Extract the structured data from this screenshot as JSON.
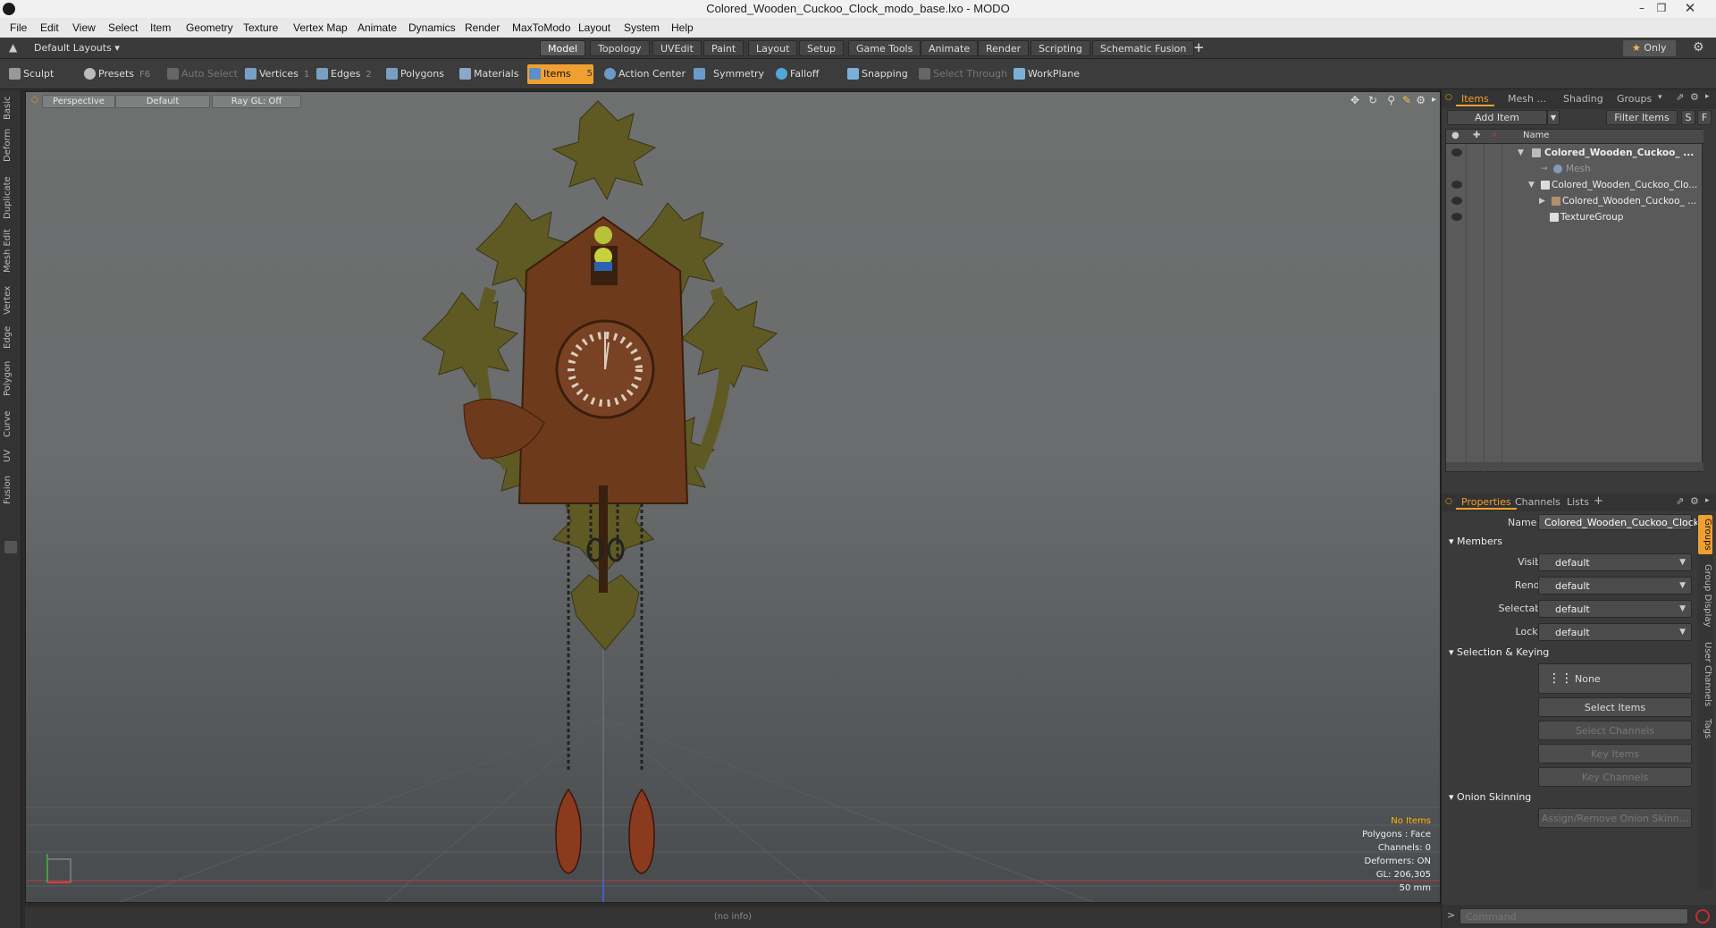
{
  "window": {
    "title": "Colored_Wooden_Cuckoo_Clock_modo_base.lxo - MODO"
  },
  "menu": [
    "File",
    "Edit",
    "View",
    "Select",
    "Item",
    "Geometry",
    "Texture",
    "Vertex Map",
    "Animate",
    "Dynamics",
    "Render",
    "MaxToModo",
    "Layout",
    "System",
    "Help"
  ],
  "layout_selector": "Default Layouts",
  "layout_tabs": [
    "Model",
    "Topology",
    "UVEdit",
    "Paint",
    "Layout",
    "Setup",
    "Game Tools",
    "Animate",
    "Render",
    "Scripting",
    "Schematic Fusion"
  ],
  "active_layout_tab": "Model",
  "only_label": "Only",
  "toolbar": {
    "sculpt": "Sculpt",
    "presets": "Presets",
    "presets_key": "F6",
    "auto_select": "Auto Select",
    "vertices": "Vertices",
    "vertices_key": "1",
    "edges": "Edges",
    "edges_key": "2",
    "polygons": "Polygons",
    "materials": "Materials",
    "items": "Items",
    "items_key": "5",
    "action_center": "Action Center",
    "symmetry": "Symmetry",
    "falloff": "Falloff",
    "snapping": "Snapping",
    "select_through": "Select Through",
    "workplane": "WorkPlane"
  },
  "left_tabs": [
    "Basic",
    "Deform",
    "Duplicate",
    "Mesh Edit",
    "Vertex",
    "Edge",
    "Polygon",
    "Curve",
    "UV",
    "Fusion"
  ],
  "viewport": {
    "view": "Perspective",
    "shading": "Default",
    "raygl": "Ray GL: Off",
    "status": {
      "selection": "No Items",
      "polygons": "Polygons : Face",
      "channels": "Channels: 0",
      "deformers": "Deformers: ON",
      "gl": "GL: 206,305",
      "focal": "50 mm"
    },
    "bottom_info": "(no info)"
  },
  "items_panel": {
    "tabs": [
      "Items",
      "Mesh ...",
      "Shading",
      "Groups"
    ],
    "add_item": "Add Item",
    "filter_items": "Filter Items",
    "filter_s": "S",
    "filter_f": "F",
    "name_header": "Name",
    "rows": [
      {
        "label": "Colored_Wooden_Cuckoo_ ..."
      },
      {
        "label": "Mesh"
      },
      {
        "label": "Colored_Wooden_Cuckoo_Clo..."
      },
      {
        "label": "Colored_Wooden_Cuckoo_ ..."
      },
      {
        "label": "TextureGroup"
      }
    ]
  },
  "properties_panel": {
    "tabs": [
      "Properties",
      "Channels",
      "Lists"
    ],
    "name_label": "Name",
    "name_value": "Colored_Wooden_Cuckoo_Clock",
    "members": "Members",
    "visible_label": "Visible",
    "render_label": "Render",
    "selectable_label": "Selectable",
    "locked_label": "Locked",
    "dropdown_value": "default",
    "selection_keying": "Selection & Keying",
    "none_label": "None",
    "select_items": "Select Items",
    "select_channels": "Select Channels",
    "key_items": "Key Items",
    "key_channels": "Key Channels",
    "onion_skinning": "Onion Skinning",
    "assign_onion": "Assign/Remove Onion Skinn...",
    "side_tabs": [
      "Groups",
      "Group Display",
      "User Channels",
      "Tags"
    ]
  },
  "command_placeholder": "Command",
  "colors": {
    "accent": "#f0a030",
    "viewport_top": "#6e7070",
    "viewport_bottom": "#484b4d"
  }
}
